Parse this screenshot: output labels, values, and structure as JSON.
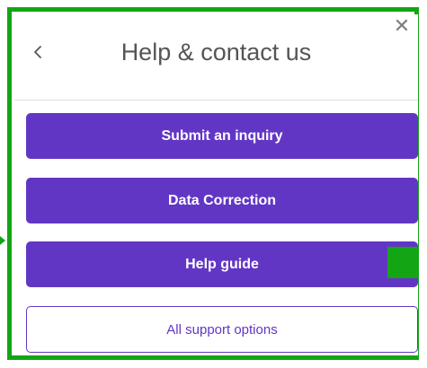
{
  "dialog": {
    "title": "Help & contact us",
    "back_icon": "chevron-left-icon",
    "close_icon": "close-icon",
    "close_glyph": "✕"
  },
  "actions": [
    {
      "label": "Submit an inquiry",
      "style": "filled"
    },
    {
      "label": "Data Correction",
      "style": "filled"
    },
    {
      "label": "Help guide",
      "style": "filled"
    },
    {
      "label": "All support options",
      "style": "outline"
    }
  ],
  "colors": {
    "primary": "#6236c5",
    "highlight": "#14a514",
    "title_text": "#555555"
  }
}
